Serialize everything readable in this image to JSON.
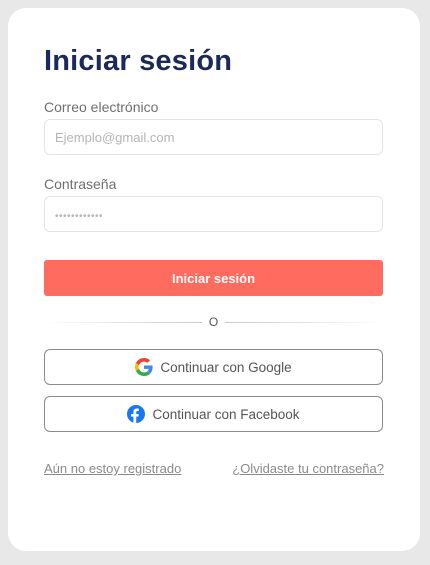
{
  "login": {
    "title": "Iniciar sesión",
    "email_label": "Correo electrónico",
    "email_placeholder": "Ejemplo@gmail.com",
    "password_label": "Contraseña",
    "password_placeholder": "••••••••••••",
    "submit_label": "Iniciar sesión",
    "divider_text": "O",
    "google_label": "Continuar con Google",
    "facebook_label": "Continuar con Facebook",
    "register_link": "Aún no estoy registrado",
    "forgot_link": "¿Olvidaste tu contraseña?"
  },
  "colors": {
    "accent": "#ff6b5e",
    "title": "#1b2a57",
    "facebook": "#1877f2"
  },
  "icons": {
    "google": "google-logo-icon",
    "facebook": "facebook-logo-icon"
  }
}
